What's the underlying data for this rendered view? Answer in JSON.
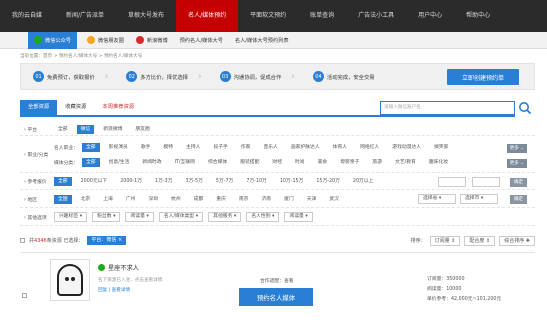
{
  "nav": [
    "我的云自媒",
    "新闻/广告派单",
    "草根大号发布",
    "名人/媒体预约",
    "平面软文预约",
    "账单查询",
    "广告法小工具",
    "用户中心",
    "帮助中心"
  ],
  "nav_active_index": 3,
  "subnav": [
    {
      "label": "微信公众号",
      "color": "#1aad19"
    },
    {
      "label": "微信朋友圈",
      "color": "#f6a623"
    },
    {
      "label": "新浪微博",
      "color": "#d42b2b"
    },
    {
      "label": "预约名人/媒体大号",
      "color": null
    },
    {
      "label": "名人/媒体大号预约列表",
      "color": null
    }
  ],
  "breadcrumb": "当前位置：首页 > 预约名人/媒体大号 > 预约名人/媒体大号",
  "steps": [
    {
      "num": "01",
      "label": "免费预订，获取报价"
    },
    {
      "num": "02",
      "label": "多方比价，择优选择"
    },
    {
      "num": "03",
      "label": "沟通协调，促成合作"
    },
    {
      "num": "04",
      "label": "活动完成，安全交易"
    }
  ],
  "cta": "立即创建预约单",
  "tabs": [
    "全部资源",
    "收藏资源",
    "本周推荐资源"
  ],
  "search_placeholder": "请输入微信账户名",
  "filters": {
    "platform": {
      "label": "平台",
      "options": [
        "全部",
        "微信",
        "新浪微博",
        "朋友圈"
      ],
      "selected": 1
    },
    "role": {
      "label": "职业/分类",
      "row1_label": "名人职业：",
      "row1": [
        "全部",
        "影视演员",
        "歌手",
        "模特",
        "主持人",
        "段子手",
        "作家",
        "音乐人",
        "画家护肤达人",
        "体育人",
        "网络红人",
        "游戏动漫达人",
        "搞笑家"
      ],
      "row2_label": "媒体分类：",
      "row2": [
        "全部",
        "创意/生活",
        "新闻时政",
        "IT/互联网",
        "综合媒体",
        "服装搭配",
        "财经",
        "时尚",
        "美食",
        "母婴亲子",
        "旅游",
        "文艺/教育",
        "趣味化妆"
      ],
      "more": "更多"
    },
    "price": {
      "label": "参考报价",
      "options": [
        "全部",
        "2000元以下",
        "2000-1万",
        "1万-3万",
        "3万-5万",
        "5万-7万",
        "7万-10万",
        "10万-15万",
        "15万-20万",
        "20万以上"
      ],
      "confirm": "确定"
    },
    "region": {
      "label": "地区",
      "options": [
        "全国",
        "北京",
        "上海",
        "广州",
        "深圳",
        "杭州",
        "成都",
        "重庆",
        "南京",
        "济南",
        "厦门",
        "天津",
        "武汉"
      ],
      "province": "选择省",
      "city": "选择市",
      "confirm": "确定"
    },
    "other": {
      "label": "其他选项",
      "options": [
        "兴趣标签",
        "粉丝数",
        "阅读量",
        "名人/媒体类型",
        "其他服务",
        "名人性别",
        "阅读量"
      ]
    }
  },
  "result": {
    "prefix": "共",
    "count": "4346",
    "suffix": "条资源 已选择：",
    "tag": "平台：微信",
    "sort_label": "排序：",
    "sorts": [
      "订阅量",
      "配合度",
      "综合排序"
    ]
  },
  "card": {
    "name": "星座不求人",
    "desc": "名下资源已入驻，点击查看详情",
    "links": [
      "回复",
      "查看详情"
    ],
    "coop": "合作适配：查看",
    "book": "预约名人媒体",
    "stats": [
      "订阅量：350000",
      "阅读量：10000",
      "单价参考：42,000元~101,200元"
    ]
  },
  "colors": {
    "nav_bg": "#2b2b2b",
    "accent_red": "#c40000",
    "accent_blue": "#2a7fd4"
  }
}
